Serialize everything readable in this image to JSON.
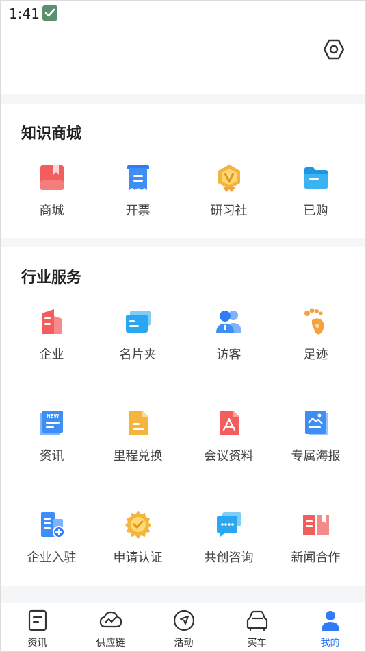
{
  "status_bar": {
    "time": "1:41",
    "notification_icon": "check-icon"
  },
  "top_bar": {
    "settings_icon": "hexagon-settings-icon"
  },
  "knowledge_mall": {
    "title": "知识商城",
    "items": [
      {
        "label": "商城",
        "icon": "bookmark-book-icon",
        "color": "#f25e5e"
      },
      {
        "label": "开票",
        "icon": "receipt-icon",
        "color": "#3f8ef5"
      },
      {
        "label": "研习社",
        "icon": "vip-badge-icon",
        "color": "#f5b53c"
      },
      {
        "label": "已购",
        "icon": "folder-icon",
        "color": "#2aa7f0"
      }
    ]
  },
  "industry_services": {
    "title": "行业服务",
    "items": [
      {
        "label": "企业",
        "icon": "building-icon",
        "color": "#f25e5e"
      },
      {
        "label": "名片夹",
        "icon": "card-holder-icon",
        "color": "#2aa7f0"
      },
      {
        "label": "访客",
        "icon": "visitors-icon",
        "color": "#3f8ef5"
      },
      {
        "label": "足迹",
        "icon": "footprint-icon",
        "color": "#f5a23c"
      },
      {
        "label": "资讯",
        "icon": "news-icon",
        "color": "#3f8ef5"
      },
      {
        "label": "里程兑换",
        "icon": "document-icon",
        "color": "#f5b53c"
      },
      {
        "label": "会议资料",
        "icon": "pdf-file-icon",
        "color": "#f25e5e"
      },
      {
        "label": "专属海报",
        "icon": "poster-icon",
        "color": "#3f8ef5"
      },
      {
        "label": "企业入驻",
        "icon": "building-add-icon",
        "color": "#3f8ef5"
      },
      {
        "label": "申请认证",
        "icon": "certified-badge-icon",
        "color": "#f5b53c"
      },
      {
        "label": "共创咨询",
        "icon": "chat-bubbles-icon",
        "color": "#2aa7f0"
      },
      {
        "label": "新闻合作",
        "icon": "open-book-icon",
        "color": "#f25e5e"
      }
    ]
  },
  "tabbar": {
    "active_color": "#2f7cf6",
    "tabs": [
      {
        "label": "资讯",
        "icon": "news-tab-icon",
        "active": false
      },
      {
        "label": "供应链",
        "icon": "cloud-chart-icon",
        "active": false
      },
      {
        "label": "活动",
        "icon": "compass-icon",
        "active": false
      },
      {
        "label": "买车",
        "icon": "car-icon",
        "active": false
      },
      {
        "label": "我的",
        "icon": "user-icon",
        "active": true
      }
    ]
  }
}
